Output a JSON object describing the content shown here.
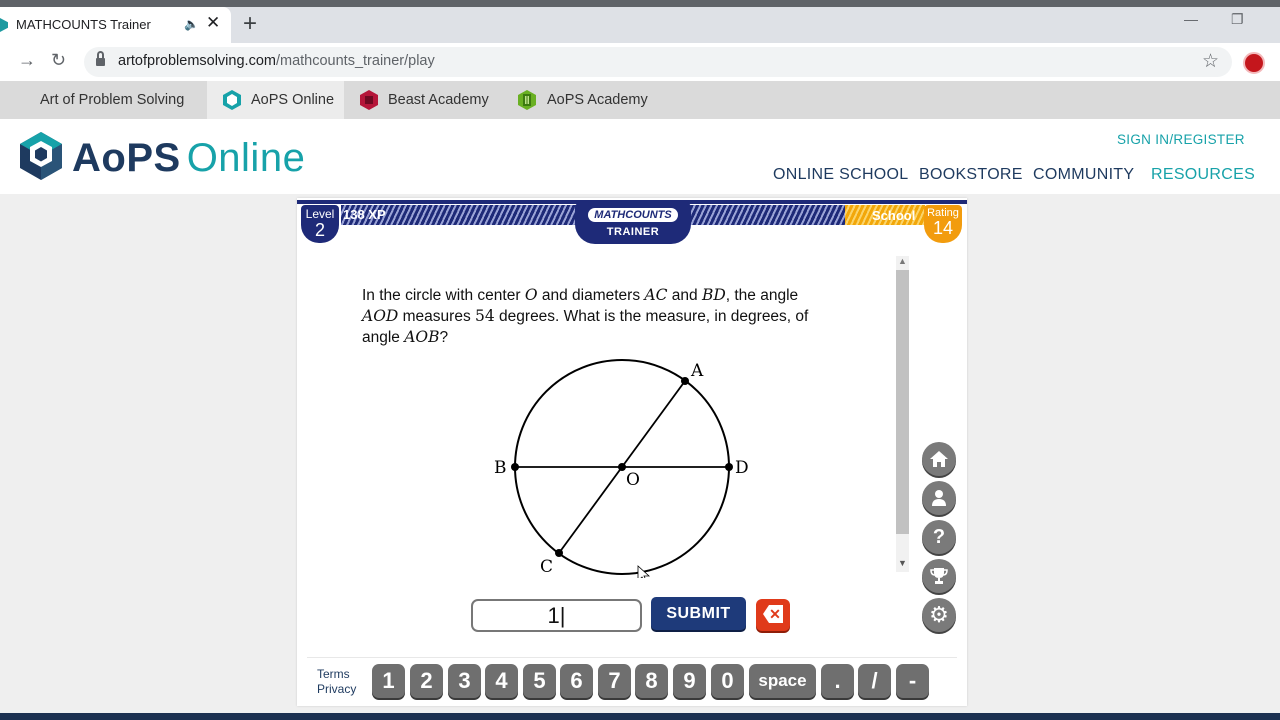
{
  "browser": {
    "tab_title": "MATHCOUNTS Trainer",
    "url_host": "artofproblemsolving.com",
    "url_path": "/mathcounts_trainer/play",
    "bookmarks": [
      "Art of Problem Solving",
      "AoPS Online",
      "Beast Academy",
      "AoPS Academy"
    ]
  },
  "site": {
    "logo_aops": "AoPS",
    "logo_online": "Online",
    "signin": "SIGN IN/REGISTER",
    "nav": [
      "ONLINE SCHOOL",
      "BOOKSTORE",
      "COMMUNITY",
      "RESOURCES"
    ],
    "active_nav": "RESOURCES"
  },
  "trainer": {
    "level_label": "Level",
    "level_value": "2",
    "xp": "138 XP",
    "brand": "MATHCOUNTS",
    "brand_sub": "TRAINER",
    "school": "School",
    "rating_label": "Rating",
    "rating_value": "14",
    "problem": {
      "line1_a": "In the circle with center ",
      "line1_o": "O",
      "line1_b": " and diameters ",
      "line1_ac": "AC",
      "line1_c": " and ",
      "line1_bd": "BD",
      "line1_d": ", the angle",
      "line2_aod": "AOD",
      "line2_a": " measures ",
      "line2_54": "54",
      "line2_b": " degrees. What is the measure, in degrees, of",
      "line3_a": "angle ",
      "line3_aob": "AOB",
      "line3_b": "?"
    },
    "figure_labels": {
      "A": "A",
      "B": "B",
      "C": "C",
      "D": "D",
      "O": "O"
    },
    "answer_value": "1",
    "submit_label": "SUBMIT",
    "footer_terms": "Terms",
    "footer_privacy": "Privacy",
    "keypad": [
      "1",
      "2",
      "3",
      "4",
      "5",
      "6",
      "7",
      "8",
      "9",
      "0",
      "space",
      ".",
      "/",
      "-"
    ],
    "side_buttons": [
      "home-icon",
      "profile-icon",
      "help-icon",
      "trophy-icon",
      "gear-icon"
    ]
  },
  "colors": {
    "brand_navy": "#1e2a78",
    "brand_teal": "#17a2a9",
    "rating_orange": "#f29c0e",
    "clear_red": "#e03a1a"
  }
}
